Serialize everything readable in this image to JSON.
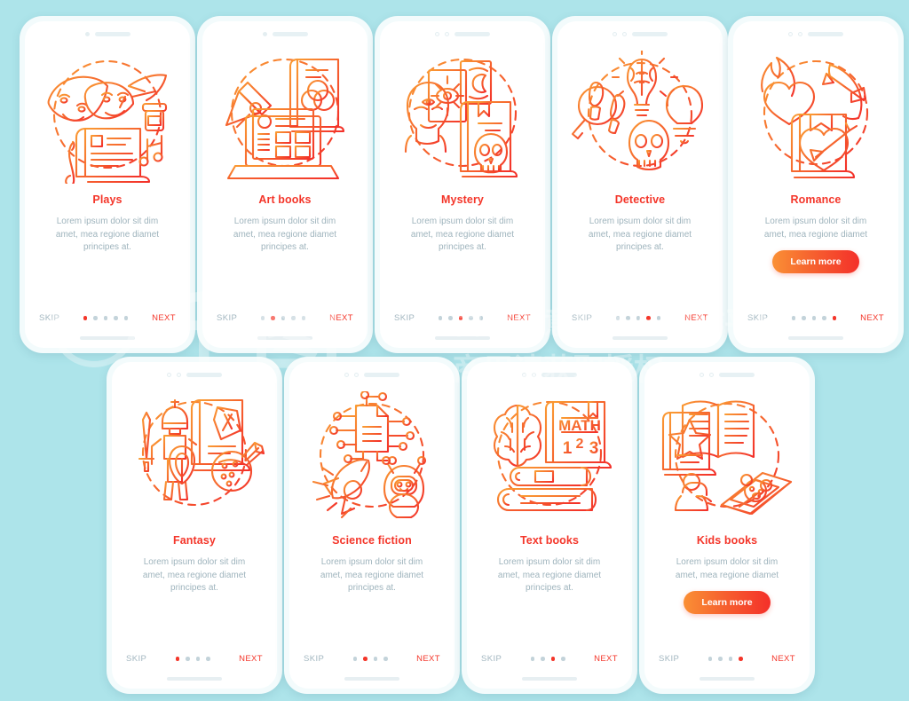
{
  "page": {
    "background_color": "#ade4ea",
    "accent_red": "#f4362a",
    "accent_orange": "#fa9035",
    "muted_text_color": "#9fb4bd"
  },
  "common": {
    "skip_label": "SKIP",
    "next_label": "NEXT",
    "learn_more_label": "Learn more",
    "body_text": "Lorem ipsum dolor sit dim amet, mea regione diamet principes at.",
    "body_text_short": "Lorem ipsum dolor sit dim amet, mea regione diamet"
  },
  "watermark": {
    "line1": "千图",
    "line2": "营销创意服务与协作平台",
    "line3": "商用请获取授权"
  },
  "screens": [
    {
      "id": "plays",
      "title": "Plays",
      "body": "Lorem ipsum dolor sit dim amet, mea regione diamet principes at.",
      "dots_total": 5,
      "dot_active": 1,
      "has_cta": false,
      "icon": "theatre-masks-quill-scroll-icon"
    },
    {
      "id": "art-books",
      "title": "Art books",
      "body": "Lorem ipsum dolor sit dim amet, mea regione diamet principes at.",
      "dots_total": 5,
      "dot_active": 2,
      "has_cta": false,
      "icon": "pen-nib-laptop-colorbook-icon"
    },
    {
      "id": "mystery",
      "title": "Mystery",
      "body": "Lorem ipsum dolor sit dim amet, mea regione diamet principes at.",
      "dots_total": 5,
      "dot_active": 3,
      "has_cta": false,
      "icon": "tarot-cards-third-eye-skull-book-icon"
    },
    {
      "id": "detective",
      "title": "Detective",
      "body": "Lorem ipsum dolor sit dim amet, mea regione diamet principes at.",
      "dots_total": 5,
      "dot_active": 4,
      "has_cta": false,
      "icon": "magnifier-footprints-bulb-brain-skull-question-icon"
    },
    {
      "id": "romance",
      "title": "Romance",
      "body": "Lorem ipsum dolor sit dim amet, mea regione diamet",
      "dots_total": 5,
      "dot_active": 5,
      "has_cta": true,
      "icon": "flaming-heart-bow-arrow-heart-book-icon"
    },
    {
      "id": "fantasy",
      "title": "Fantasy",
      "body": "Lorem ipsum dolor sit dim amet, mea regione diamet principes at.",
      "dots_total": 4,
      "dot_active": 1,
      "has_cta": false,
      "icon": "knight-sword-shield-rune-book-potion-icon"
    },
    {
      "id": "science-fiction",
      "title": "Science fiction",
      "body": "Lorem ipsum dolor sit dim amet, mea regione diamet principes at.",
      "dots_total": 4,
      "dot_active": 2,
      "has_cta": false,
      "icon": "circuit-page-rocket-robot-icon"
    },
    {
      "id": "text-books",
      "title": "Text books",
      "body": "Lorem ipsum dolor sit dim amet, mea regione diamet principes at.",
      "dots_total": 4,
      "dot_active": 3,
      "has_cta": false,
      "icon": "brain-math-book-stack-icon",
      "icon_labels": {
        "math": "MATH",
        "one": "1",
        "two": "2",
        "three": "3"
      }
    },
    {
      "id": "kids-books",
      "title": "Kids books",
      "body": "Lorem ipsum dolor sit dim amet, mea regione diamet",
      "dots_total": 4,
      "dot_active": 4,
      "has_cta": true,
      "icon": "star-book-open-book-child-teddy-book-icon"
    }
  ]
}
